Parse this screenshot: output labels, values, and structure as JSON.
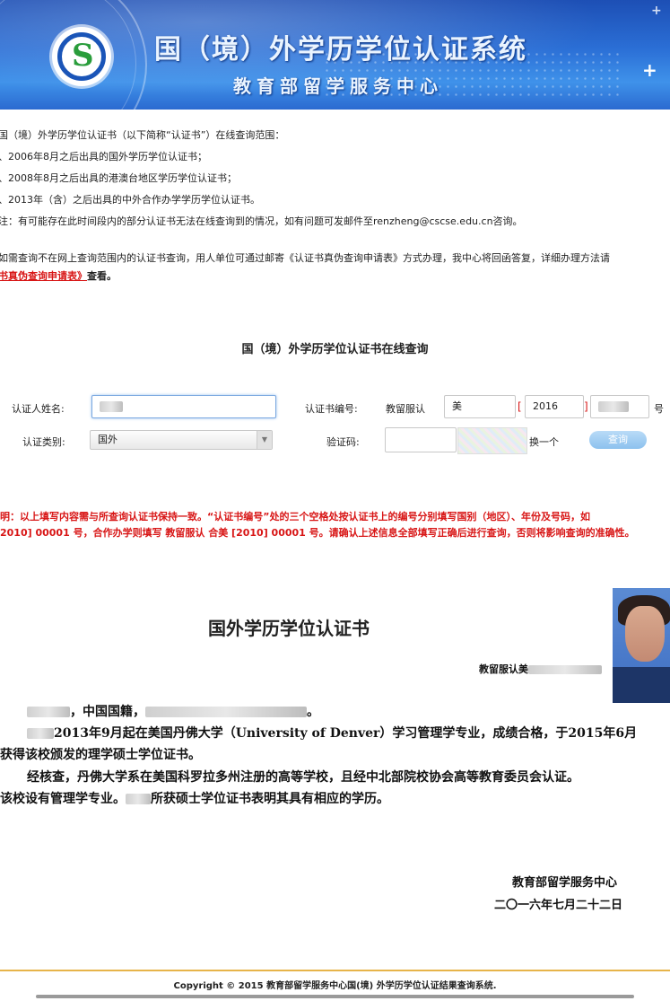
{
  "banner": {
    "title": "国（境）外学历学位认证系统",
    "subtitle": "教育部留学服务中心"
  },
  "intro": {
    "line1": "国（境）外学历学位认证书（以下简称“认证书”）在线查询范围：",
    "line2": "、2006年8月之后出具的国外学历学位认证书；",
    "line3": "、2008年8月之后出具的港澳台地区学历学位认证书；",
    "line4": "、2013年（含）之后出具的中外合作办学学历学位认证书。",
    "note": "注：有可能存在此时间段内的部分认证书无法在线查询到的情况，如有问题可发邮件至renzheng@cscse.edu.cn咨询。",
    "para1": "如需查询不在网上查询范围内的认证书查询，用人单位可通过邮寄《认证书真伪查询申请表》方式办理，我中心将回函答复，详细办理方法请",
    "link": "书真伪查询申请表》",
    "link_suffix": "查看。"
  },
  "form": {
    "title": "国（境）外学历学位认证书在线查询",
    "name_label": "认证人姓名:",
    "cert_no_label": "认证书编号:",
    "cert_prefix": "教留服认",
    "country_value": "美",
    "year_value": "2016",
    "number_suffix": "号",
    "category_label": "认证类别:",
    "category_value": "国外",
    "captcha_label": "验证码:",
    "refresh_label": "换一个",
    "query_button": "查询"
  },
  "notice": {
    "line1": "明：以上填写内容需与所查询认证书保持一致。“认证书编号”处的三个空格处按认证书上的编号分别填写国别（地区）、年份及号码，如",
    "line2": "2010] 00001 号，合作办学则填写 教留服认 合美 [2010] 00001 号。请确认上述信息全部填写正确后进行查询，否则将影响查询的准确性。"
  },
  "certificate": {
    "title": "国外学历学位认证书",
    "number_label": "教留服认美",
    "line1": "，中国国籍，",
    "line2": "2013年9月起在美国丹佛大学（University of Denver）学习管理学专业，成绩合格，于2015年6月",
    "line3": "获得该校颁发的理学硕士学位证书。",
    "line4": "经核查，丹佛大学系在美国科罗拉多州注册的高等学校，且经中北部院校协会高等教育委员会认证。",
    "line5_a": "该校设有管理学专业。",
    "line5_b": "所获硕士学位证书表明其具有相应的学历。",
    "issuer": "教育部留学服务中心",
    "date": "二〇一六年七月二十二日"
  },
  "footer": {
    "copyright": "Copyright © 2015 教育部留学服务中心国(境) 外学历学位认证结果查询系统."
  }
}
